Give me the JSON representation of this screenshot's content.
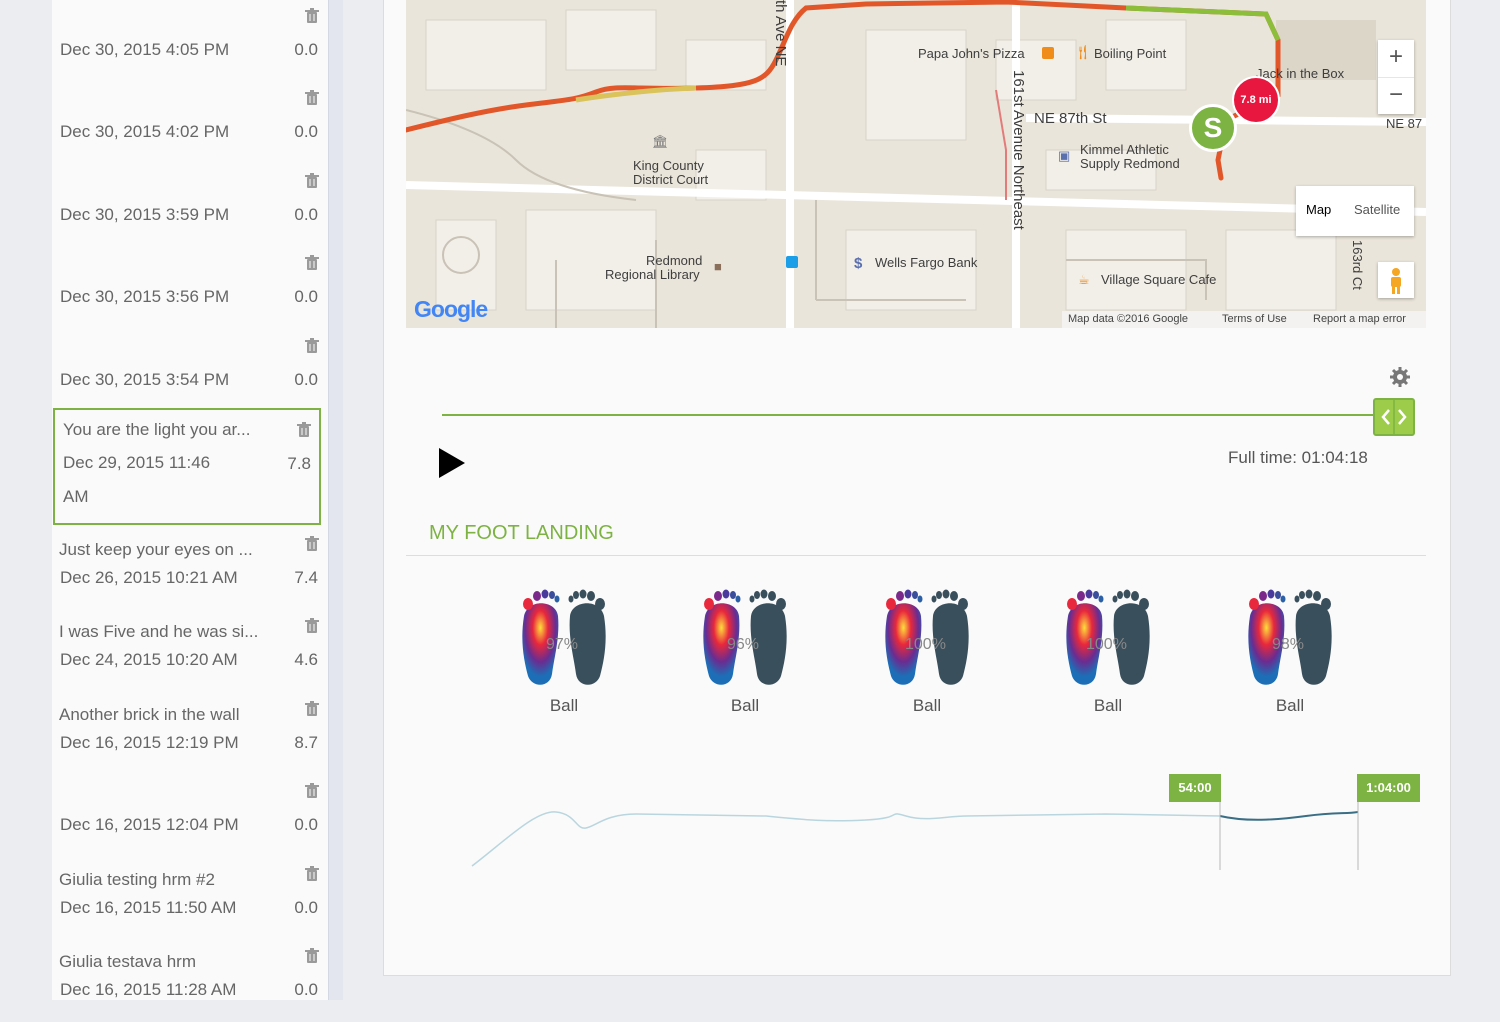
{
  "activities": [
    {
      "title": "",
      "date": "Dec 30, 2015 4:05 PM",
      "value": "0.0"
    },
    {
      "title": "",
      "date": "Dec 30, 2015 4:02 PM",
      "value": "0.0"
    },
    {
      "title": "",
      "date": "Dec 30, 2015 3:59 PM",
      "value": "0.0"
    },
    {
      "title": "",
      "date": "Dec 30, 2015 3:56 PM",
      "value": "0.0"
    },
    {
      "title": "",
      "date": "Dec 30, 2015 3:54 PM",
      "value": "0.0"
    },
    {
      "title": "You are the light you ar...",
      "date": "Dec 29, 2015 11:46 AM",
      "value": "7.8"
    },
    {
      "title": "Just keep your eyes on ...",
      "date": "Dec 26, 2015 10:21 AM",
      "value": "7.4"
    },
    {
      "title": "I was Five and he was si...",
      "date": "Dec 24, 2015 10:20 AM",
      "value": "4.6"
    },
    {
      "title": "Another brick in the wall",
      "date": "Dec 16, 2015 12:19 PM",
      "value": "8.7"
    },
    {
      "title": "",
      "date": "Dec 16, 2015 12:04 PM",
      "value": "0.0"
    },
    {
      "title": "Giulia testing hrm #2",
      "date": "Dec 16, 2015 11:50 AM",
      "value": "0.0"
    },
    {
      "title": "Giulia testava hrm",
      "date": "Dec 16, 2015 11:28 AM",
      "value": "0.0"
    }
  ],
  "map": {
    "labels": {
      "papa_johns": "Papa John's Pizza",
      "boiling_point": "Boiling Point",
      "jack_in_the_box": "Jack in the Box",
      "ne87": "NE 87th St",
      "ne87_right": "NE 87",
      "kimmel": "Kimmel Athletic",
      "kimmel2": "Supply Redmond",
      "king_county": "King County",
      "king_county2": "District Court",
      "library": "Redmond",
      "library2": "Regional Library",
      "wells_fargo": "Wells Fargo Bank",
      "village": "Village Square Cafe",
      "ave161": "161st Avenue Northeast",
      "ct163": "163rd Ct",
      "ave_ne": "th Ave NE"
    },
    "distance_marker": "7.8 mi",
    "start_marker": "S",
    "zoom_in": "+",
    "zoom_out": "−",
    "type_map": "Map",
    "type_satellite": "Satellite",
    "google_logo": "Google",
    "footer_data": "Map data ©2016 Google",
    "footer_terms": "Terms of Use",
    "footer_report": "Report a map error"
  },
  "player": {
    "full_time_label": "Full time: 01:04:18",
    "progress": 1.0
  },
  "foot_landing": {
    "title": "MY FOOT LANDING",
    "items": [
      {
        "percent": "97%",
        "label": "Ball"
      },
      {
        "percent": "96%",
        "label": "Ball"
      },
      {
        "percent": "100%",
        "label": "Ball"
      },
      {
        "percent": "100%",
        "label": "Ball"
      },
      {
        "percent": "98%",
        "label": "Ball"
      }
    ]
  },
  "timeline": {
    "flag1": "54:00",
    "flag2": "1:04:00"
  },
  "colors": {
    "accent": "#7cb342",
    "distance_marker": "#e8173f"
  }
}
